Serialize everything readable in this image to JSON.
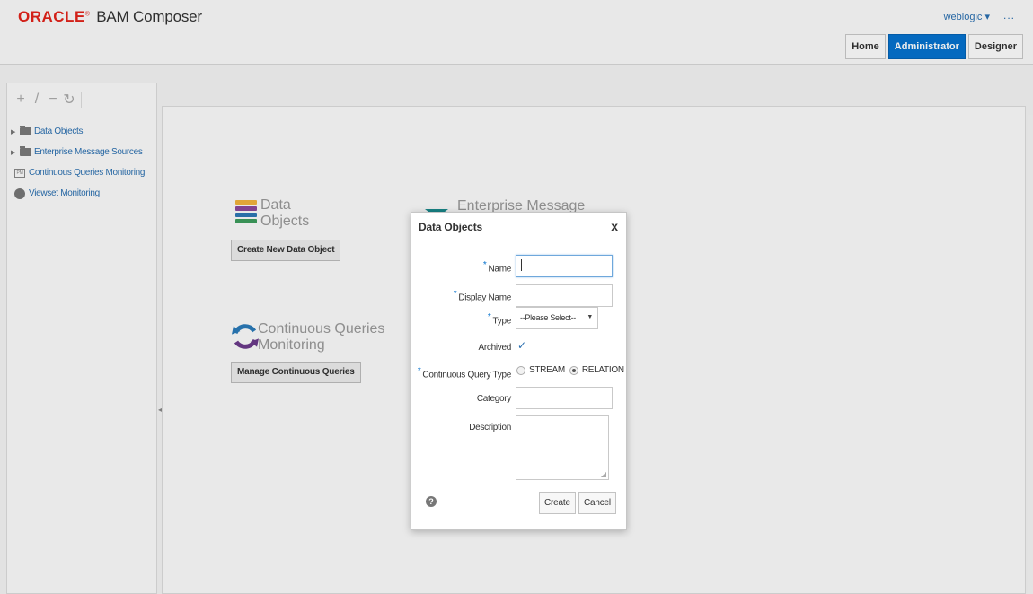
{
  "header": {
    "brand": "ORACLE",
    "product": "BAM Composer",
    "user": "weblogic ▾",
    "more": "...",
    "nav_tabs": [
      {
        "label": "Home"
      },
      {
        "label": "Administrator",
        "active": true
      },
      {
        "label": "Designer"
      }
    ]
  },
  "sidebar": {
    "toolbar_icons": [
      "add-icon",
      "edit-icon",
      "remove-icon",
      "refresh-icon"
    ],
    "items": [
      {
        "label": "Data Objects",
        "icon": "folder-icon"
      },
      {
        "label": "Enterprise Message Sources",
        "icon": "folder-icon"
      },
      {
        "label": "Continuous Queries Monitoring",
        "icon": "query-icon"
      },
      {
        "label": "Viewset Monitoring",
        "icon": "viewset-icon"
      }
    ]
  },
  "main": {
    "data_objects": {
      "title_line1": "Data",
      "title_line2": "Objects",
      "button": "Create New Data Object"
    },
    "ems": {
      "title": "Enterprise Message"
    },
    "cq": {
      "title_line1": "Continuous Queries",
      "title_line2": "Monitoring",
      "button": "Manage Continuous Queries"
    }
  },
  "dialog": {
    "title": "Data Objects",
    "close": "x",
    "fields": {
      "name_label": "Name",
      "name_value": "",
      "display_name_label": "Display Name",
      "display_name_value": "",
      "type_label": "Type",
      "type_value": "--Please Select--",
      "archived_label": "Archived",
      "archived_checked": true,
      "cq_type_label": "Continuous Query Type",
      "cq_type_options": [
        "STREAM",
        "RELATION"
      ],
      "cq_type_selected": "RELATION",
      "category_label": "Category",
      "category_value": "",
      "description_label": "Description",
      "description_value": ""
    },
    "help": "?",
    "create_label": "Create",
    "cancel_label": "Cancel"
  },
  "colors": {
    "brand_red": "#e2231a",
    "accent_blue": "#0572ce",
    "link_blue": "#2a6fb0",
    "stack_yellow": "#f2b33d",
    "stack_purple": "#8b4a9b",
    "stack_blue": "#2e78b5",
    "stack_green": "#3e9d5d",
    "ems_teal": "#1a8a8f"
  }
}
